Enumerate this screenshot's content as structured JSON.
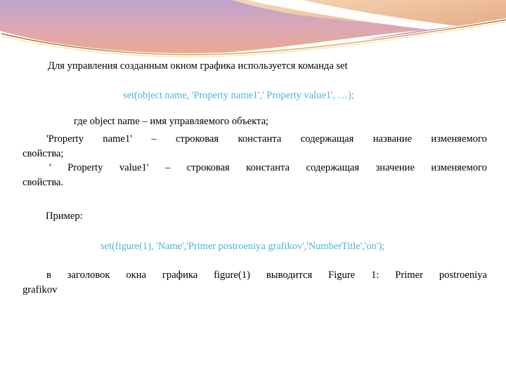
{
  "slide": {
    "background_color": "#ffffff",
    "text_color": "#000000",
    "code_color": "#4CB5D6",
    "banner": {
      "name": "decorative-wave-banner",
      "gradient_stops": [
        "#c3a8cf",
        "#d7a9c0",
        "#e8a894",
        "#f0c9a4",
        "#e9b48f"
      ],
      "accent_gold": "#c99b4e",
      "accent_purple": "#b07fad",
      "accent_rose": "#d89b9c",
      "accent_peach": "#edbf9a"
    },
    "lines": {
      "intro": "Для управления созданным окном графика используется команда set",
      "code_syntax": "set(object name, 'Property name1',' Property value1', …);",
      "def_object": "где object name – имя управляемого объекта;",
      "def_prop_name_a": "'Property",
      "def_prop_name_b": "name1'",
      "def_prop_name_c": "–",
      "def_prop_name_d": "строковая",
      "def_prop_name_e": "константа",
      "def_prop_name_f": "содержащая",
      "def_prop_name_g": "название",
      "def_prop_name_h": "изменяемого",
      "def_prop_name_tail": "свойства;",
      "def_prop_val_a": "'",
      "def_prop_val_b": "Property",
      "def_prop_val_c": "value1'",
      "def_prop_val_d": "–",
      "def_prop_val_e": "строковая",
      "def_prop_val_f": "константа",
      "def_prop_val_g": "содержащая",
      "def_prop_val_h": "значение",
      "def_prop_val_i": "изменяемого",
      "def_prop_val_tail": "свойства.",
      "example_label": "Пример:",
      "code_example": "set(figure(1), 'Name','Primer postroeniya grafikov','NumberTitle','on');",
      "result_a": "в",
      "result_b": "заголовок",
      "result_c": "окна",
      "result_d": "графика",
      "result_e": "figure(1)",
      "result_f": "выводится",
      "result_g": "Figure",
      "result_h": "1:",
      "result_i": "Primer",
      "result_j": "postroeniya",
      "result_tail": "grafikov"
    }
  }
}
